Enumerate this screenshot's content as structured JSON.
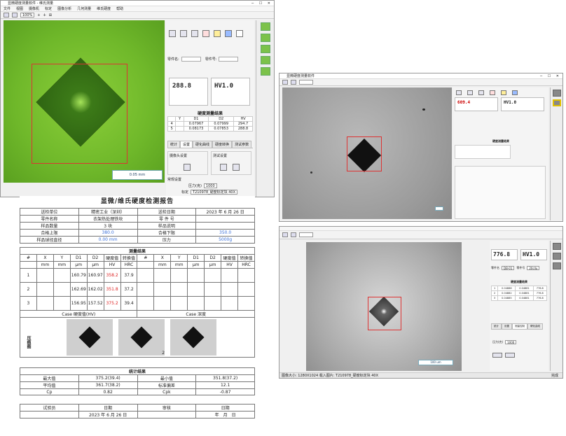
{
  "green_window": {
    "title": "显微硬度测量软件 - 维氏测量",
    "menu": [
      "文件",
      "视图",
      "摄像机",
      "标定",
      "图像分析",
      "几何测量",
      "维氏硬度",
      "帮助"
    ],
    "zoom": "100%",
    "scale_label": "0.05 mm",
    "part_name_label": "零件名:",
    "part_no_label": "零件号:",
    "hardness_value": "288.8",
    "hardness_scale": "HV1.0",
    "results_title": "硬度测量结果",
    "results_columns": [
      "Y",
      "D1",
      "D2",
      "HV"
    ],
    "results_rows": [
      {
        "idx": "4",
        "d1": "0.07967",
        "d2": "0.07999",
        "hv": "294.7"
      },
      {
        "idx": "5",
        "d1": "0.08173",
        "d2": "0.07853",
        "hv": "288.8"
      }
    ],
    "tabs": [
      "统计",
      "设置",
      "硬化曲线",
      "硬度转换",
      "测试参数"
    ],
    "group1": "摄像头设置",
    "group2": "测试设置",
    "conventional_label": "常规设置",
    "force_label": "压力(克)",
    "force_value": "1000",
    "calib_label": "标定",
    "calib_value": "T210978_硬度标定块 40X"
  },
  "gray_window_1": {
    "title": "显微硬度测量软件",
    "hardness_value": "609.4",
    "hardness_scale": "HV1.0",
    "results_title": "硬度测量结果"
  },
  "gray_window_2": {
    "hardness_value": "776.8",
    "hardness_scale": "HV1.0",
    "part_name_label": "零件名",
    "part_name_value": "DB-01",
    "part_no_label": "零件号",
    "part_no_value": "20cllu",
    "results_title": "硬度测量结果",
    "rows": [
      {
        "idx": "1",
        "d1": "0.04888",
        "d2": "0.04881",
        "hv": "776.8"
      },
      {
        "idx": "2",
        "d1": "0.04882",
        "d2": "0.04881",
        "hv": "776.8"
      },
      {
        "idx": "3",
        "d1": "0.04885",
        "d2": "0.04881",
        "hv": "776.8"
      }
    ],
    "tabs": [
      "统计",
      "设置",
      "测量控制",
      "硬化曲线"
    ],
    "force_label": "压力(克)",
    "force_value": "1000",
    "scale_label": "100 um",
    "status": "图像大小: 1280X1024   载入图片: T210978_硬度标定块 40X",
    "status_right": "完成"
  },
  "report": {
    "title": "显微/维氏硬度检测报告",
    "info": [
      [
        "送检单位",
        "精密工业（深圳）",
        "送检日期",
        "2023 年 6 月 26 日"
      ],
      [
        "零件名称",
        "衣架热处理铁块",
        "零 件 号",
        ""
      ],
      [
        "样品数量",
        "3 块",
        "样品说明",
        ""
      ],
      [
        "合格上限",
        "380.0",
        "合格下限",
        "350.0"
      ],
      [
        "样品球径直径",
        "0.00 mm",
        "压力",
        "5000g"
      ]
    ],
    "measure_title": "测量结果",
    "measure_headers": [
      "#",
      "X",
      "Y",
      "D1",
      "D2",
      "硬度值",
      "转换值",
      "#",
      "X",
      "Y",
      "D1",
      "D2",
      "硬度值",
      "转换值"
    ],
    "measure_units": [
      "",
      "mm",
      "mm",
      "μm",
      "μm",
      "HV",
      "HRC",
      "",
      "mm",
      "mm",
      "μm",
      "μm",
      "HV",
      "HRC"
    ],
    "measure_rows": [
      [
        "1",
        "",
        "",
        "160.79",
        "160.97",
        "358.2",
        "37.9"
      ],
      [
        "2",
        "",
        "",
        "162.69",
        "162.02",
        "351.8",
        "37.2"
      ],
      [
        "3",
        "",
        "",
        "156.95",
        "157.52",
        "375.2",
        "39.4"
      ]
    ],
    "case_hardness_label": "Case 硬度值(HV)",
    "case_depth_label": "Case 深度",
    "indent_photos_label": "压痕图",
    "photo_numbers": [
      "1.",
      "2.",
      "3."
    ],
    "stats_title": "统计结果",
    "stats": [
      [
        "最大值",
        "375.2(39.4)",
        "最小值",
        "351.8(37.2)"
      ],
      [
        "平均值",
        "361.7(38.2)",
        "标准偏差",
        "12.1"
      ],
      [
        "Cp",
        "0.82",
        "Cpk",
        "-0.87"
      ]
    ],
    "footer": [
      [
        "试验员",
        "日期",
        "审核",
        "日期"
      ],
      [
        "",
        "2023 年 6 月 26 日",
        "",
        "年　月　日"
      ]
    ]
  }
}
